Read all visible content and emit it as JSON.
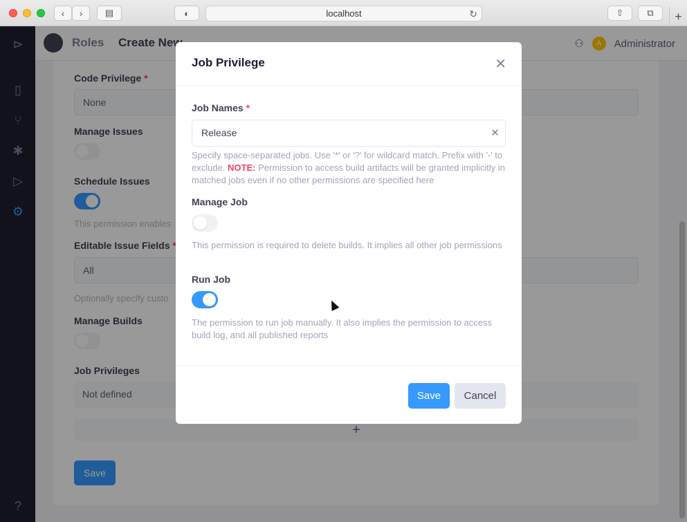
{
  "browser": {
    "url": "localhost"
  },
  "topbar": {
    "crumb_1": "Roles",
    "crumb_2": "Create New",
    "user": "Administrator",
    "avatar_letter": "A"
  },
  "background_form": {
    "code_privilege_label": "Code Privilege",
    "code_privilege_value": "None",
    "manage_issues_label": "Manage Issues",
    "schedule_issues_label": "Schedule Issues",
    "schedule_issues_hint": "This permission enables",
    "editable_issue_fields_label": "Editable Issue Fields",
    "editable_issue_fields_value": "All",
    "editable_issue_fields_hint": "Optionally specify custo",
    "manage_builds_label": "Manage Builds",
    "job_privileges_label": "Job Privileges",
    "job_privileges_value": "Not defined",
    "save_label": "Save"
  },
  "modal": {
    "title": "Job Privilege",
    "job_names_label": "Job Names",
    "job_names_value": "Release",
    "job_names_hint_1": "Specify space-separated jobs. Use '*' or '?' for wildcard match. Prefix with '-' to exclude.",
    "job_names_note": "NOTE:",
    "job_names_hint_2": "Permission to access build artifacts will be granted implicitly in matched jobs even if no other permissions are specified here",
    "manage_job_label": "Manage Job",
    "manage_job_hint": "This permission is required to delete builds. It implies all other job permissions",
    "run_job_label": "Run Job",
    "run_job_hint": "The permission to run job manually. It also implies the permission to access build log, and all published reports",
    "save_label": "Save",
    "cancel_label": "Cancel"
  },
  "toggles": {
    "manage_issues": false,
    "schedule_issues": true,
    "manage_builds": false,
    "manage_job": false,
    "run_job": true
  },
  "colors": {
    "accent": "#3699ff",
    "required": "#f1416c",
    "sidebar": "#1e1e2d"
  }
}
